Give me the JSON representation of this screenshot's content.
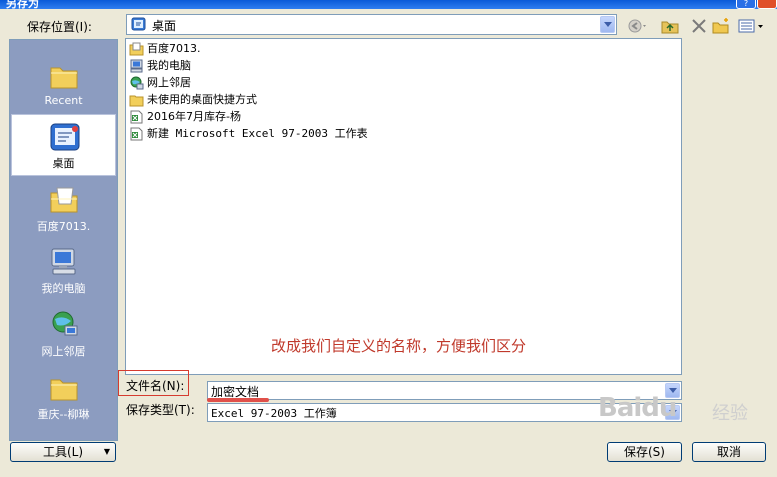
{
  "window": {
    "title": "另存为",
    "help_glyph": "?"
  },
  "top": {
    "save_in_label": "保存位置(I):",
    "location_value": "桌面",
    "toolbar_icons": [
      "back-icon",
      "up-folder-icon",
      "delete-icon",
      "new-folder-icon",
      "views-icon"
    ]
  },
  "places": [
    {
      "label": "Recent",
      "icon": "recent-folder-icon"
    },
    {
      "label": "桌面",
      "icon": "desktop-icon",
      "selected": true
    },
    {
      "label": "百度7013.",
      "icon": "user-folder-icon"
    },
    {
      "label": "我的电脑",
      "icon": "my-computer-icon"
    },
    {
      "label": "网上邻居",
      "icon": "network-icon"
    },
    {
      "label": "重庆--柳琳",
      "icon": "folder-icon"
    }
  ],
  "files": [
    {
      "name": "百度7013.",
      "icon": "user-folder-icon"
    },
    {
      "name": "我的电脑",
      "icon": "my-computer-icon"
    },
    {
      "name": "网上邻居",
      "icon": "network-icon"
    },
    {
      "name": "未使用的桌面快捷方式",
      "icon": "folder-icon"
    },
    {
      "name": "2016年7月库存-杨",
      "icon": "excel-file-icon"
    },
    {
      "name": "新建 Microsoft Excel 97-2003 工作表",
      "icon": "excel-file-icon"
    }
  ],
  "annotation": "改成我们自定义的名称，方便我们区分",
  "filename": {
    "label": "文件名(N):",
    "value": "加密文档"
  },
  "filetype": {
    "label": "保存类型(T):",
    "value": "Excel 97-2003 工作簿"
  },
  "buttons": {
    "tools": "工具(L)",
    "save": "保存(S)",
    "cancel": "取消"
  },
  "watermark": {
    "brand": "Baidu",
    "suffix": "经验"
  },
  "colors": {
    "title_bar": "#0a5ad8",
    "places_bar": "#8c9cc0",
    "annotation": "#c0392b"
  }
}
